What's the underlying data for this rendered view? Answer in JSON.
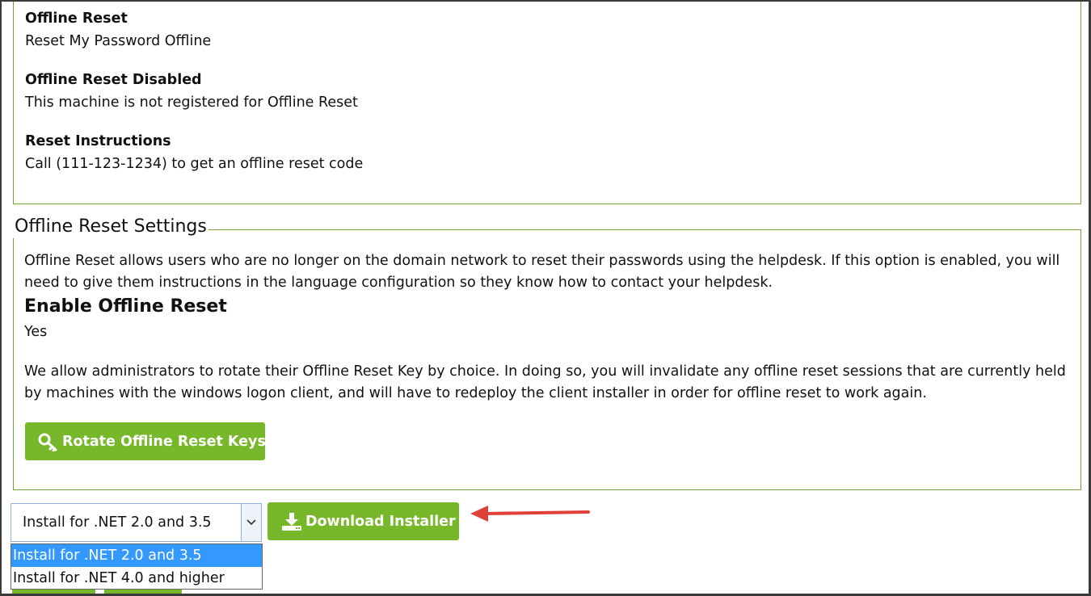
{
  "info": {
    "offline_reset_label": "Offline Reset",
    "offline_reset_value": "Reset My Password Offline",
    "disabled_label": "Offline Reset Disabled",
    "disabled_value": "This machine is not registered for Offline Reset",
    "instructions_label": "Reset Instructions",
    "instructions_value": "Call (111-123-1234) to get an offline reset code"
  },
  "settings": {
    "legend": "Offline Reset Settings",
    "description": "Offline Reset allows users who are no longer on the domain network to reset their passwords using the helpdesk. If this option is enabled, you will need to give them instructions in the language configuration so they know how to contact your helpdesk.",
    "enable_heading": "Enable Offline Reset",
    "enable_value": "Yes",
    "rotate_description": "We allow administrators to rotate their Offline Reset Key by choice. In doing so, you will invalidate any offline reset sessions that are currently held by machines with the windows logon client, and will have to redeploy the client installer in order for offline reset to work again.",
    "rotate_button_label": "Rotate Offline Reset Keys",
    "rotate_icon": "key-icon"
  },
  "installer": {
    "selected": "Install for .NET 2.0 and 3.5",
    "options": [
      "Install for .NET 2.0 and 3.5",
      "Install for .NET 4.0 and higher"
    ],
    "download_label": "Download Installer",
    "download_icon": "download-icon"
  },
  "colors": {
    "accent_green": "#76b82a",
    "border_green": "#7aa03a",
    "highlight_blue": "#3399ff",
    "annotation_red": "#e0403a"
  }
}
